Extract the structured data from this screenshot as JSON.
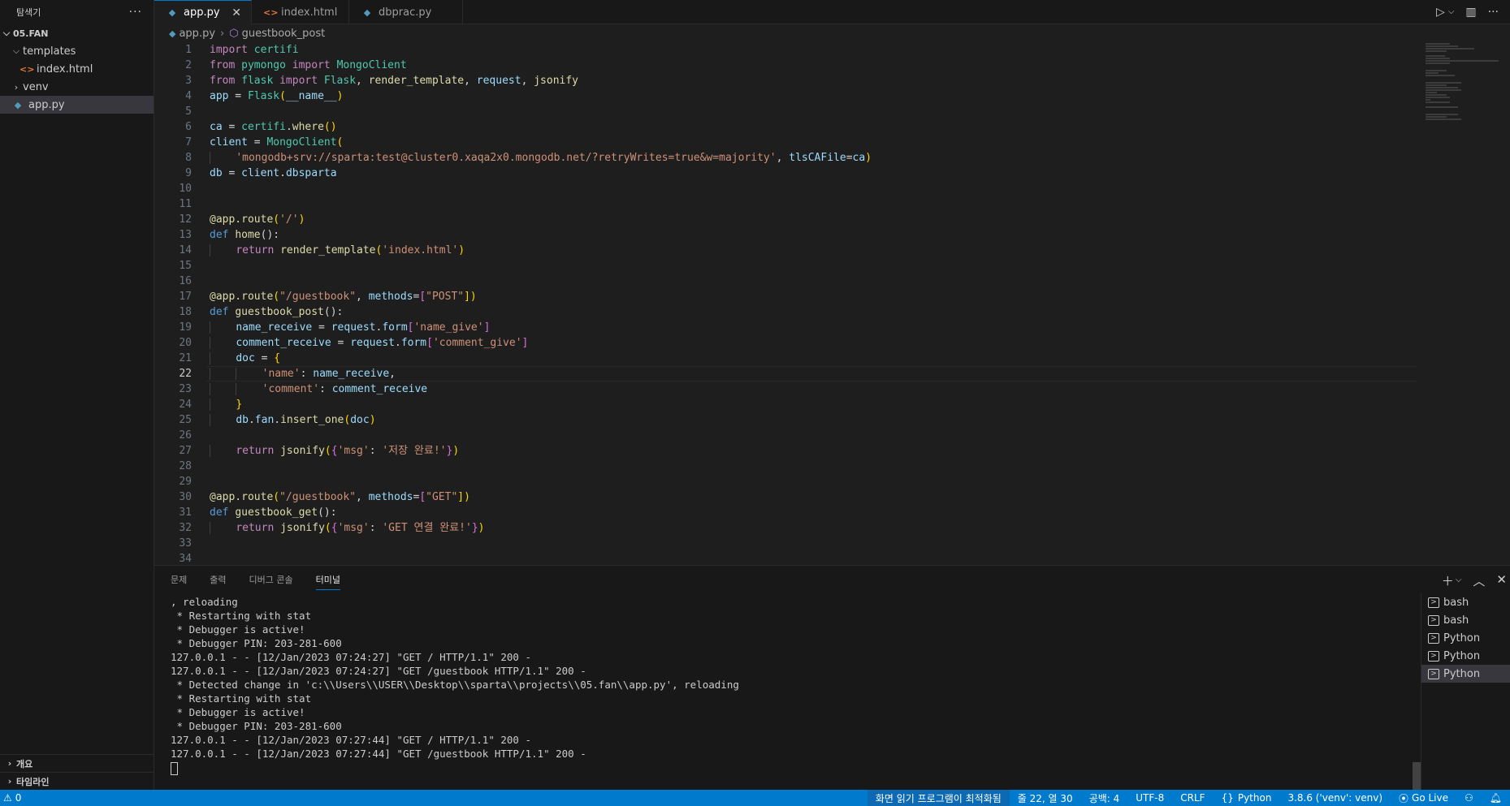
{
  "sidebar": {
    "title": "탐색기",
    "more": "···",
    "folder": "05.FAN",
    "items": [
      {
        "label": "templates",
        "type": "folder"
      },
      {
        "label": "index.html",
        "type": "html"
      },
      {
        "label": "venv",
        "type": "folder"
      },
      {
        "label": "app.py",
        "type": "python"
      }
    ],
    "outline_label": "개요",
    "timeline_label": "타임라인"
  },
  "tabs": [
    {
      "label": "app.py",
      "icon": "python-icon",
      "active": true
    },
    {
      "label": "index.html",
      "icon": "html-icon",
      "active": false
    },
    {
      "label": "dbprac.py",
      "icon": "python-icon",
      "active": false
    }
  ],
  "breadcrumb": {
    "file": "app.py",
    "symbol": "guestbook_post"
  },
  "editor": {
    "current_line": 22,
    "line_numbers": [
      "1",
      "2",
      "3",
      "4",
      "5",
      "6",
      "7",
      "8",
      "9",
      "10",
      "11",
      "12",
      "13",
      "14",
      "15",
      "16",
      "17",
      "18",
      "19",
      "20",
      "21",
      "22",
      "23",
      "24",
      "25",
      "26",
      "27",
      "28",
      "29",
      "30",
      "31",
      "32",
      "33",
      "34"
    ]
  },
  "code": {
    "l1": [
      "import",
      "certifi"
    ],
    "l2": [
      "from",
      "pymongo",
      "import",
      "MongoClient"
    ],
    "l3": [
      "from",
      "flask",
      "import",
      "Flask",
      ", ",
      "render_template",
      ", ",
      "request",
      ", ",
      "jsonify"
    ],
    "l4": [
      "app",
      " = ",
      "Flask",
      "(",
      "__name__",
      ")"
    ],
    "l6": [
      "ca",
      " = ",
      "certifi",
      ".",
      "where",
      "()"
    ],
    "l7": [
      "client",
      " = ",
      "MongoClient",
      "("
    ],
    "l8": [
      "'mongodb+srv://sparta:test@cluster0.xaqa2x0.mongodb.net/?retryWrites=true&w=majority'",
      ", ",
      "tlsCAFile",
      "=",
      "ca",
      ")"
    ],
    "l9": [
      "db",
      " = ",
      "client",
      ".",
      "dbsparta"
    ],
    "l12": [
      "@app.route",
      "(",
      "'/'",
      ")"
    ],
    "l13": [
      "def",
      "home",
      "():"
    ],
    "l14": [
      "return",
      "render_template",
      "(",
      "'index.html'",
      ")"
    ],
    "l17": [
      "@app.route",
      "(",
      "\"/guestbook\"",
      ", ",
      "methods",
      "=",
      "[",
      "\"POST\"",
      "])"
    ],
    "l18": [
      "def",
      "guestbook_post",
      "():"
    ],
    "l19": [
      "name_receive",
      " = ",
      "request",
      ".",
      "form",
      "[",
      "'name_give'",
      "]"
    ],
    "l20": [
      "comment_receive",
      " = ",
      "request",
      ".",
      "form",
      "[",
      "'comment_give'",
      "]"
    ],
    "l21": [
      "doc",
      " = ",
      "{"
    ],
    "l22": [
      "'name'",
      ": ",
      "name_receive",
      ","
    ],
    "l23": [
      "'comment'",
      ": ",
      "comment_receive"
    ],
    "l24": [
      "}"
    ],
    "l25": [
      "db",
      ".",
      "fan",
      ".",
      "insert_one",
      "(",
      "doc",
      ")"
    ],
    "l27": [
      "return",
      "jsonify",
      "(",
      "{",
      "'msg'",
      ": ",
      "'저장 완료!'",
      "}",
      ")"
    ],
    "l30": [
      "@app.route",
      "(",
      "\"/guestbook\"",
      ", ",
      "methods",
      "=",
      "[",
      "\"GET\"",
      "])"
    ],
    "l31": [
      "def",
      "guestbook_get",
      "():"
    ],
    "l32": [
      "return",
      "jsonify",
      "(",
      "{",
      "'msg'",
      ": ",
      "'GET 연결 완료!'",
      "}",
      ")"
    ]
  },
  "panel": {
    "tabs": [
      "문제",
      "출력",
      "디버그 콘솔",
      "터미널"
    ],
    "active_tab": "터미널",
    "terminal_lines": [
      ", reloading",
      " * Restarting with stat",
      " * Debugger is active!",
      " * Debugger PIN: 203-281-600",
      "127.0.0.1 - - [12/Jan/2023 07:24:27] \"GET / HTTP/1.1\" 200 -",
      "127.0.0.1 - - [12/Jan/2023 07:24:27] \"GET /guestbook HTTP/1.1\" 200 -",
      " * Detected change in 'c:\\\\Users\\\\USER\\\\Desktop\\\\sparta\\\\projects\\\\05.fan\\\\app.py', reloading",
      " * Restarting with stat",
      " * Debugger is active!",
      " * Debugger PIN: 203-281-600",
      "127.0.0.1 - - [12/Jan/2023 07:27:44] \"GET / HTTP/1.1\" 200 -",
      "127.0.0.1 - - [12/Jan/2023 07:27:44] \"GET /guestbook HTTP/1.1\" 200 -"
    ],
    "terminals": [
      "bash",
      "bash",
      "Python",
      "Python",
      "Python"
    ],
    "selected_terminal": 4
  },
  "statusbar": {
    "problems": "0",
    "screen_reader": "화면 읽기 프로그램이 최적화됨",
    "position": "줄 22, 열 30",
    "indent": "공백: 4",
    "encoding": "UTF-8",
    "eol": "CRLF",
    "language": "Python",
    "interpreter": "3.8.6 ('venv': venv)",
    "golive": "Go Live"
  },
  "colors": {
    "accent": "#007acc",
    "editor_bg": "#1e1e1e",
    "sidebar_bg": "#181818"
  }
}
